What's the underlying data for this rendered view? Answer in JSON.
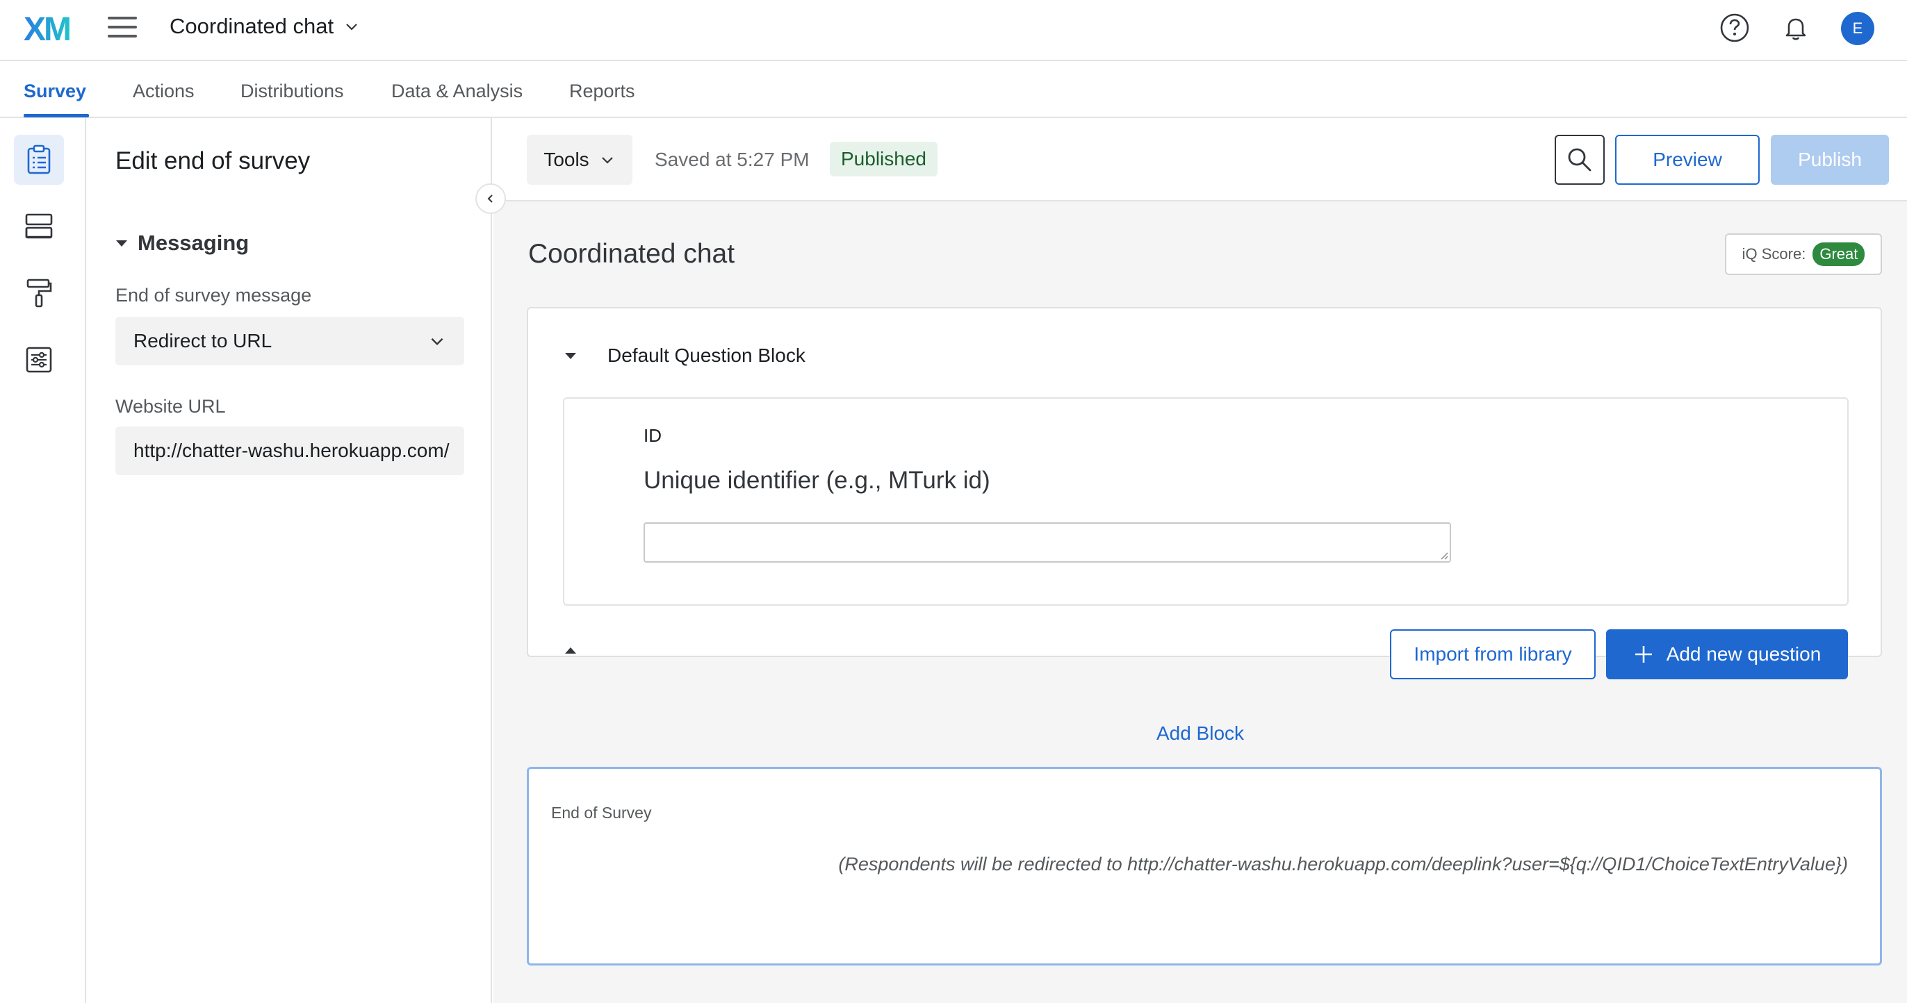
{
  "header": {
    "logo": "XM",
    "project_title": "Coordinated chat",
    "avatar_initial": "E"
  },
  "tabs": [
    {
      "label": "Survey",
      "active": true
    },
    {
      "label": "Actions"
    },
    {
      "label": "Distributions"
    },
    {
      "label": "Data & Analysis"
    },
    {
      "label": "Reports"
    }
  ],
  "rail": {
    "items": [
      "survey-icon",
      "blocks-icon",
      "look-and-feel-icon",
      "survey-options-icon"
    ]
  },
  "edit_panel": {
    "title": "Edit end of survey",
    "section": "Messaging",
    "end_message_label": "End of survey message",
    "end_message_value": "Redirect to URL",
    "url_label": "Website URL",
    "url_value": "http://chatter-washu.herokuapp.com/"
  },
  "toolbar": {
    "tools_label": "Tools",
    "saved_text": "Saved at 5:27 PM",
    "status_badge": "Published",
    "preview_label": "Preview",
    "publish_label": "Publish"
  },
  "survey": {
    "title": "Coordinated chat",
    "iq_score_label": "iQ Score:",
    "iq_score_value": "Great",
    "block": {
      "name": "Default Question Block",
      "question": {
        "id": "ID",
        "text": "Unique identifier (e.g., MTurk id)"
      },
      "import_label": "Import from library",
      "add_question_label": "Add new question"
    },
    "add_block_label": "Add Block",
    "end_of_survey": {
      "label": "End of Survey",
      "message": "(Respondents will be redirected to http://chatter-washu.herokuapp.com/deeplink?user=${q://QID1/ChoiceTextEntryValue})"
    }
  },
  "colors": {
    "accent": "#1e68d0",
    "logo_gradient_start": "#2a7de1",
    "logo_gradient_end": "#21c3c9",
    "published_bg": "#e7f3ea",
    "iq_great": "#2d8a3e"
  }
}
